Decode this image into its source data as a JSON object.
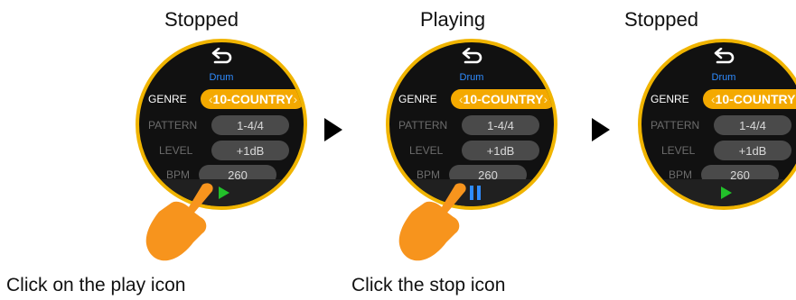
{
  "states": [
    {
      "title": "Stopped"
    },
    {
      "title": "Playing"
    },
    {
      "title": "Stopped"
    }
  ],
  "panel": {
    "title": "Drum",
    "genre_label": "GENRE",
    "genre_value": "10-COUNTRY",
    "pattern_label": "PATTERN",
    "pattern_value": "1-4/4",
    "level_label": "LEVEL",
    "level_value": "+1dB",
    "bpm_label": "BPM",
    "bpm_value": "260"
  },
  "captions": {
    "play": "Click on the play icon",
    "stop": "Click the stop icon"
  },
  "colors": {
    "accent": "#f4a900",
    "play_green": "#22c12a",
    "pause_blue": "#2f8cff",
    "hand_orange": "#f7941d"
  },
  "icons": [
    "back-icon",
    "play-icon",
    "pause-icon",
    "right-arrow-icon",
    "pointing-hand-icon"
  ]
}
